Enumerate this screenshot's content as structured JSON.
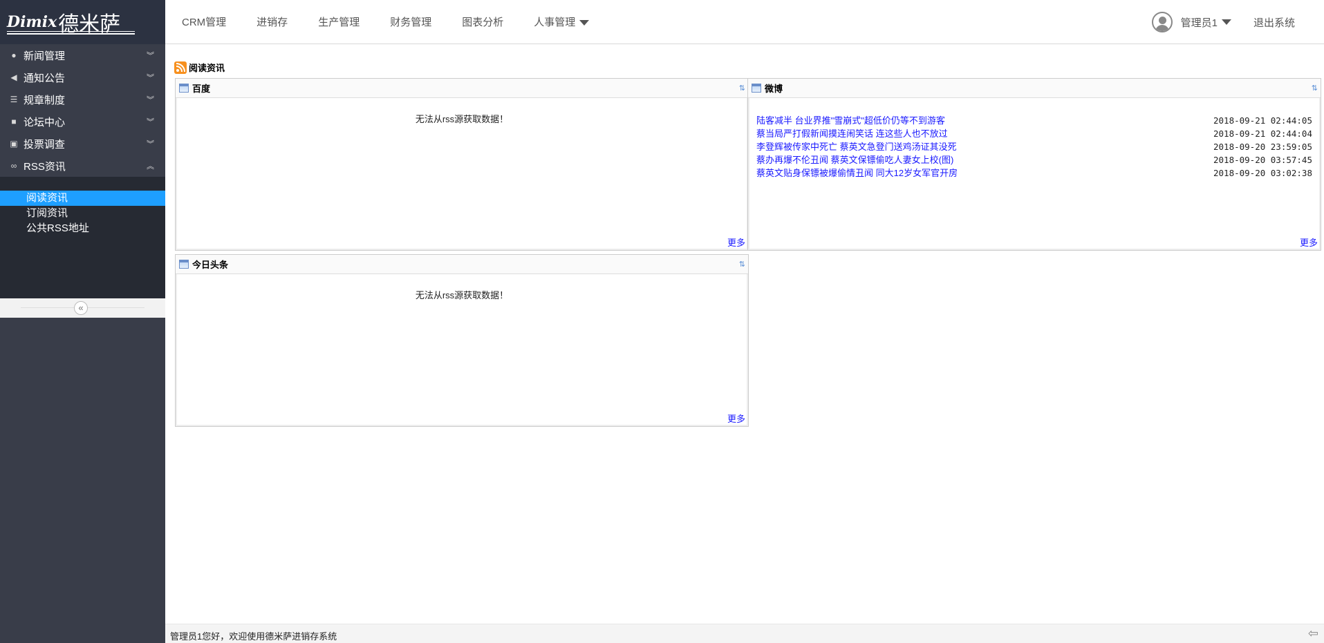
{
  "brand": {
    "en": "Dimix",
    "cn": "德米萨"
  },
  "topnav": [
    {
      "label": "CRM管理"
    },
    {
      "label": "进销存"
    },
    {
      "label": "生产管理"
    },
    {
      "label": "财务管理"
    },
    {
      "label": "图表分析"
    },
    {
      "label": "人事管理"
    }
  ],
  "user": {
    "name": "管理员1",
    "logout": "退出系统"
  },
  "sidebar": {
    "items": [
      {
        "label": "新闻管理",
        "icon": "globe-icon"
      },
      {
        "label": "通知公告",
        "icon": "bullhorn-icon"
      },
      {
        "label": "规章制度",
        "icon": "list-icon"
      },
      {
        "label": "论坛中心",
        "icon": "chat-icon"
      },
      {
        "label": "投票调查",
        "icon": "clipboard-icon"
      },
      {
        "label": "RSS资讯",
        "icon": "link-icon"
      }
    ],
    "subitems": [
      {
        "label": "阅读资讯"
      },
      {
        "label": "订阅资讯"
      },
      {
        "label": "公共RSS地址"
      }
    ]
  },
  "content": {
    "title": "阅读资讯",
    "panels": {
      "baidu": {
        "title": "百度",
        "empty": "无法从rss源获取数据！",
        "more": "更多"
      },
      "weibo": {
        "title": "微博",
        "more": "更多",
        "rows": [
          {
            "title": "陆客减半 台业界推\"雪崩式\"超低价仍等不到游客",
            "time": "2018-09-21 02:44:05"
          },
          {
            "title": "蔡当局严打假新闻摸连闹笑话 连这些人也不放过",
            "time": "2018-09-21 02:44:04"
          },
          {
            "title": "李登辉被传家中死亡 蔡英文急登门送鸡汤证其没死",
            "time": "2018-09-20 23:59:05"
          },
          {
            "title": "蔡办再爆不伦丑闻 蔡英文保镖偷吃人妻女上校(图)",
            "time": "2018-09-20 03:57:45"
          },
          {
            "title": "蔡英文贴身保镖被爆偷情丑闻 同大12岁女军官开房",
            "time": "2018-09-20 03:02:38"
          }
        ]
      },
      "toutiao": {
        "title": "今日头条",
        "empty": "无法从rss源获取数据！",
        "more": "更多"
      }
    }
  },
  "footer": {
    "text": "管理员1您好，欢迎使用德米萨进销存系统"
  }
}
